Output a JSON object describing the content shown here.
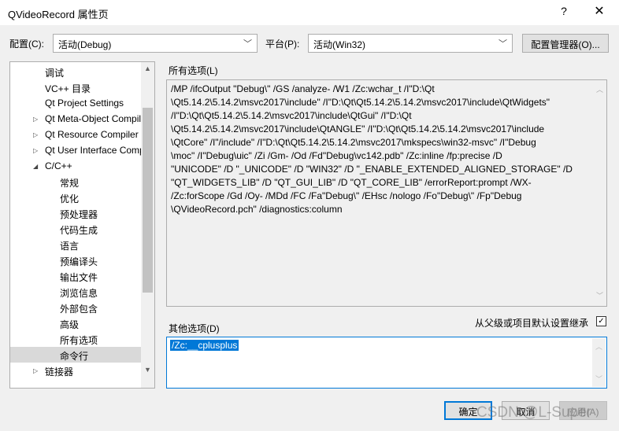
{
  "window": {
    "title": "QVideoRecord 属性页",
    "help": "?",
    "close": "✕"
  },
  "config": {
    "label": "配置(C):",
    "value": "活动(Debug)",
    "platform_label": "平台(P):",
    "platform_value": "活动(Win32)",
    "manager_button": "配置管理器(O)..."
  },
  "tree": {
    "items": [
      {
        "label": "调试",
        "level": 1,
        "expander": ""
      },
      {
        "label": "VC++ 目录",
        "level": 1,
        "expander": ""
      },
      {
        "label": "Qt Project Settings",
        "level": 1,
        "expander": ""
      },
      {
        "label": "Qt Meta-Object Compiler",
        "level": 1,
        "expander": "collapsed"
      },
      {
        "label": "Qt Resource Compiler",
        "level": 1,
        "expander": "collapsed"
      },
      {
        "label": "Qt User Interface Compiler",
        "level": 1,
        "expander": "collapsed"
      },
      {
        "label": "C/C++",
        "level": 1,
        "expander": "expanded"
      },
      {
        "label": "常规",
        "level": 2,
        "expander": ""
      },
      {
        "label": "优化",
        "level": 2,
        "expander": ""
      },
      {
        "label": "预处理器",
        "level": 2,
        "expander": ""
      },
      {
        "label": "代码生成",
        "level": 2,
        "expander": ""
      },
      {
        "label": "语言",
        "level": 2,
        "expander": ""
      },
      {
        "label": "预编译头",
        "level": 2,
        "expander": ""
      },
      {
        "label": "输出文件",
        "level": 2,
        "expander": ""
      },
      {
        "label": "浏览信息",
        "level": 2,
        "expander": ""
      },
      {
        "label": "外部包含",
        "level": 2,
        "expander": ""
      },
      {
        "label": "高级",
        "level": 2,
        "expander": ""
      },
      {
        "label": "所有选项",
        "level": 2,
        "expander": ""
      },
      {
        "label": "命令行",
        "level": 2,
        "expander": "",
        "selected": true
      },
      {
        "label": "链接器",
        "level": 1,
        "expander": "collapsed"
      }
    ]
  },
  "all_options": {
    "label": "所有选项(L)",
    "text": "/MP /ifcOutput \"Debug\\\" /GS /analyze- /W1 /Zc:wchar_t /I\"D:\\Qt\n\\Qt5.14.2\\5.14.2\\msvc2017\\include\" /I\"D:\\Qt\\Qt5.14.2\\5.14.2\\msvc2017\\include\\QtWidgets\"\n/I\"D:\\Qt\\Qt5.14.2\\5.14.2\\msvc2017\\include\\QtGui\" /I\"D:\\Qt\n\\Qt5.14.2\\5.14.2\\msvc2017\\include\\QtANGLE\" /I\"D:\\Qt\\Qt5.14.2\\5.14.2\\msvc2017\\include\n\\QtCore\" /I\"/include\" /I\"D:\\Qt\\Qt5.14.2\\5.14.2\\msvc2017\\mkspecs\\win32-msvc\" /I\"Debug\n\\moc\" /I\"Debug\\uic\" /Zi /Gm- /Od /Fd\"Debug\\vc142.pdb\" /Zc:inline /fp:precise /D\n\"UNICODE\" /D \"_UNICODE\" /D \"WIN32\" /D \"_ENABLE_EXTENDED_ALIGNED_STORAGE\" /D\n\"QT_WIDGETS_LIB\" /D \"QT_GUI_LIB\" /D \"QT_CORE_LIB\" /errorReport:prompt /WX-\n/Zc:forScope /Gd /Oy- /MDd /FC /Fa\"Debug\\\" /EHsc /nologo /Fo\"Debug\\\" /Fp\"Debug\n\\QVideoRecord.pch\" /diagnostics:column"
  },
  "other_options": {
    "label": "其他选项(D)",
    "value": "/Zc:__cplusplus",
    "inherit_label": "从父级或项目默认设置继承",
    "inherit_checked": true
  },
  "buttons": {
    "ok": "确定",
    "cancel": "取消",
    "apply": "应用(A)"
  },
  "watermark": "CSDN @L-Super",
  "colors": {
    "accent": "#0078d7",
    "background": "#f0f0f0"
  }
}
